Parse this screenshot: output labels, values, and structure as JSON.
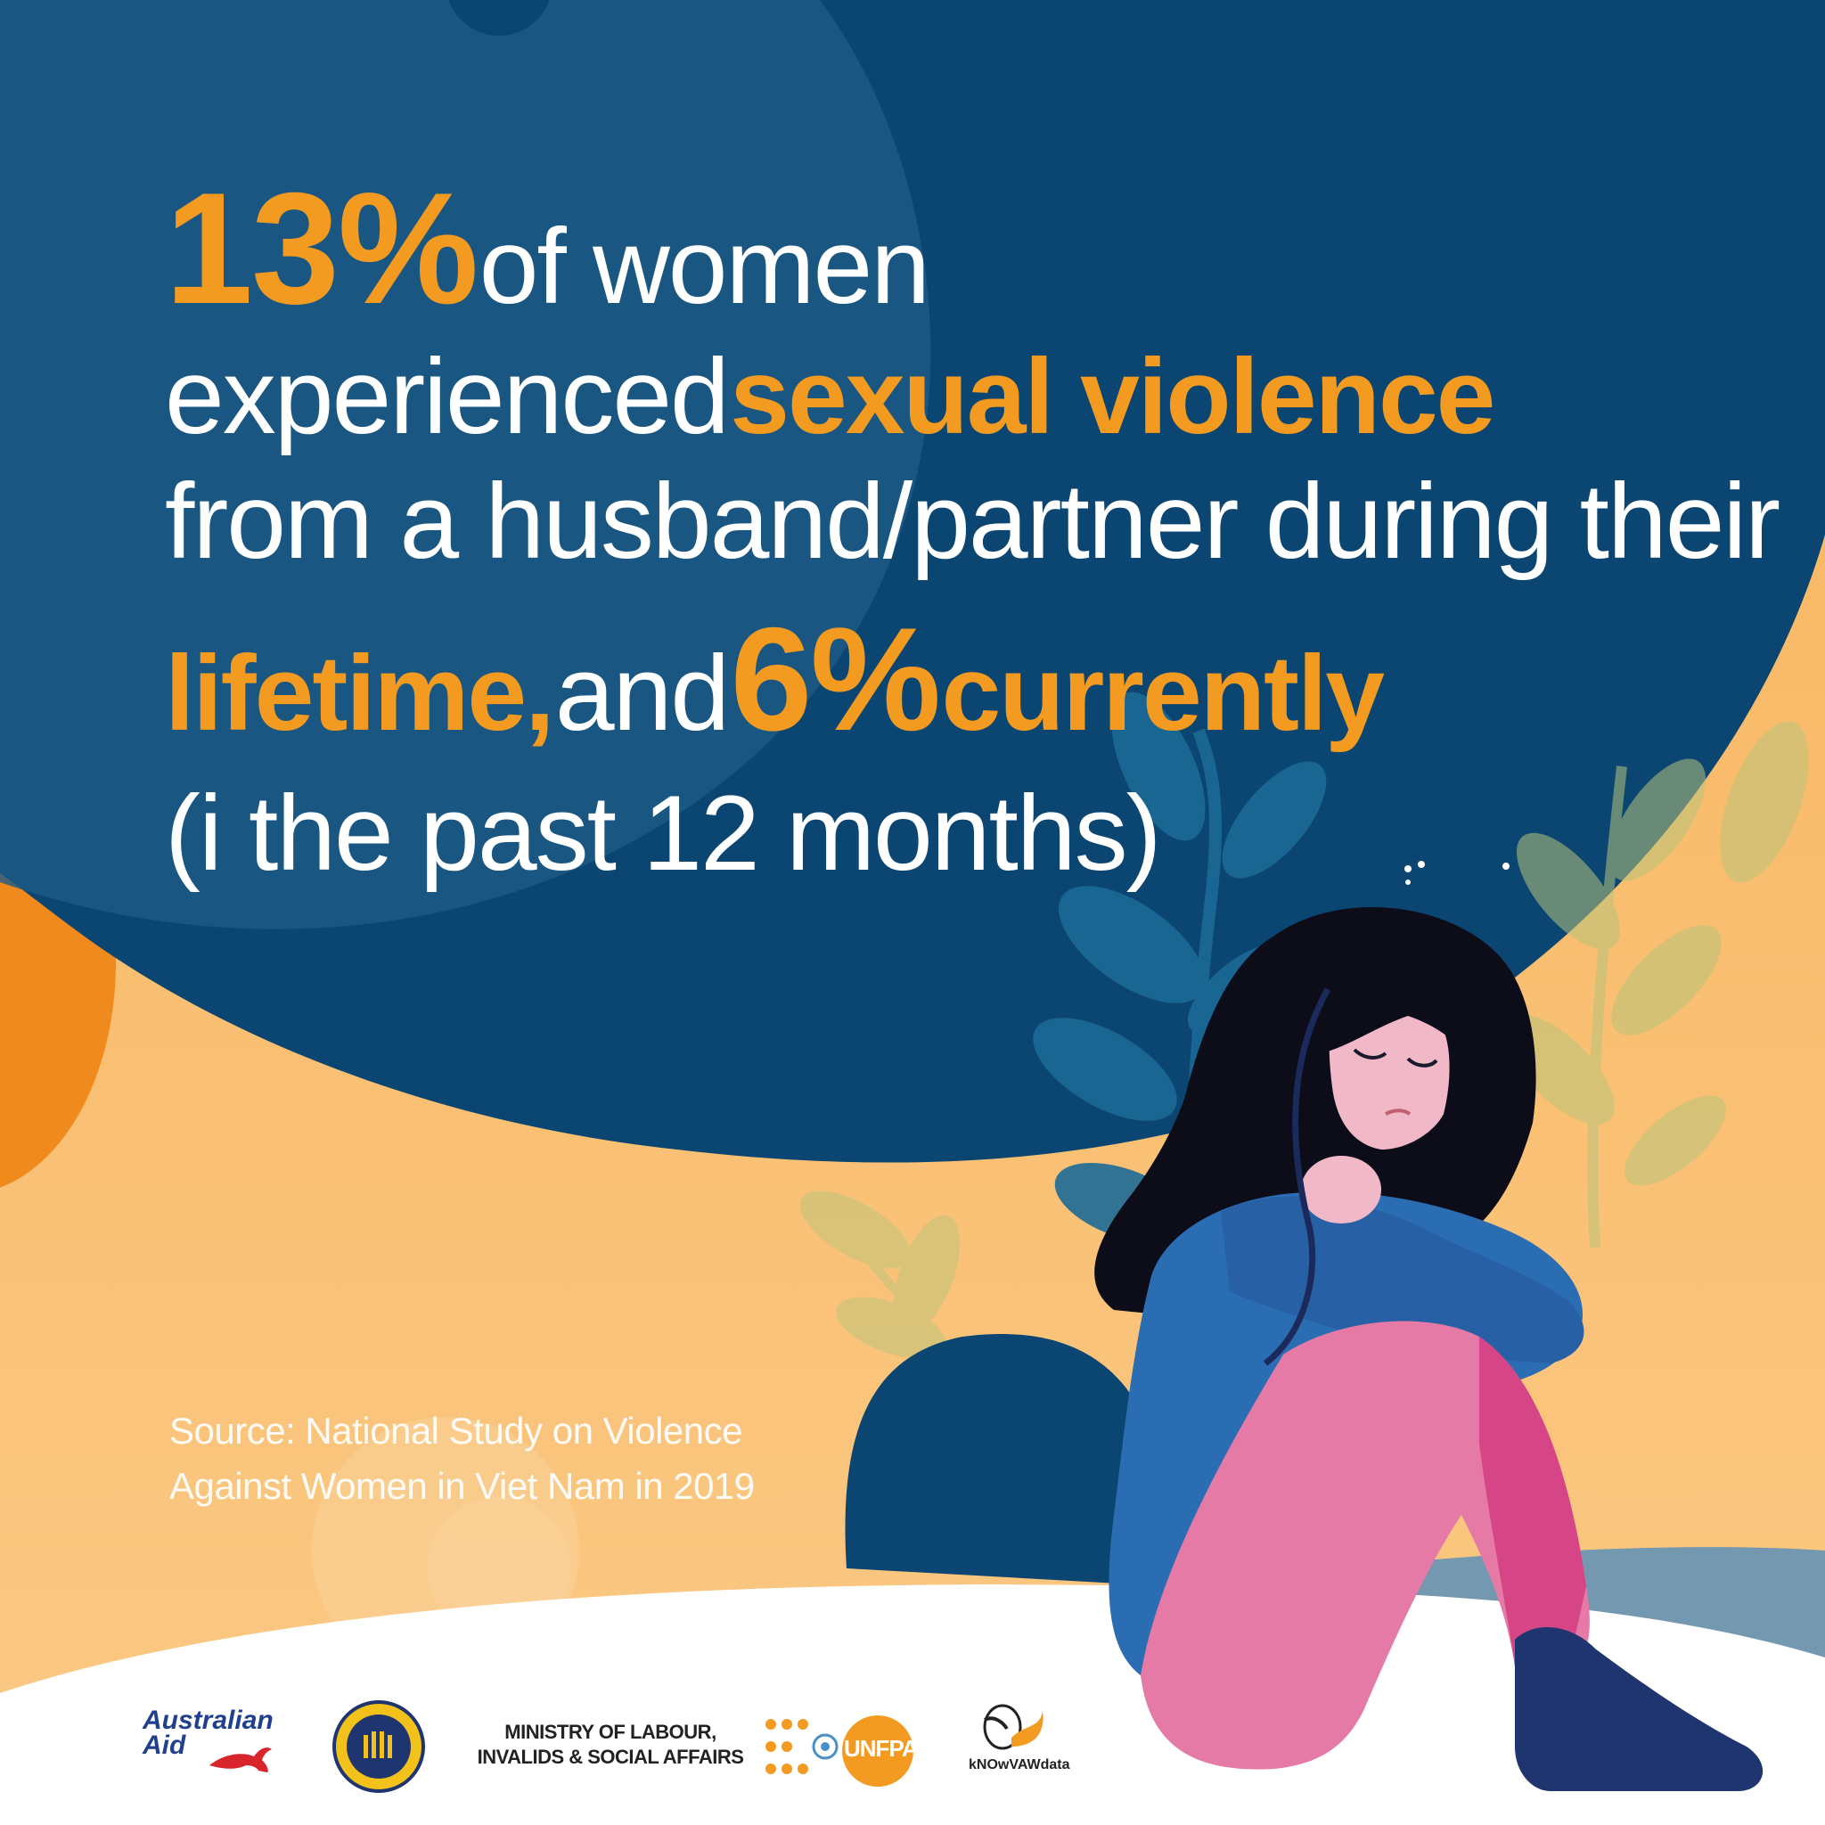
{
  "headline": {
    "stat_main": "13%",
    "of_women": "of women",
    "experienced": "experienced",
    "sexual_violence": "sexual violence",
    "from_partner": "from a husband/partner during their",
    "lifetime": "lifetime,",
    "and": "and",
    "stat_current": "6%",
    "currently": "currently",
    "past_months": "(i the past 12 months)"
  },
  "source": {
    "line1": "Source: National Study on Violence",
    "line2": "Against Women in Viet Nam in 2019"
  },
  "logos": {
    "australian_aid_line1": "Australian",
    "australian_aid_line2": "Aid",
    "molisa_line1": "MINISTRY OF LABOUR,",
    "molisa_line2": "INVALIDS & SOCIAL AFFAIRS",
    "unfpa": "UNFPA",
    "knowvawdata": "kNOwVAWdata"
  },
  "colors": {
    "navy": "#0b4571",
    "orange": "#f39a21",
    "light_orange": "#f7b965",
    "white": "#ffffff",
    "blue_shirt": "#2b6db3",
    "pink_pants": "#e67aa6"
  }
}
